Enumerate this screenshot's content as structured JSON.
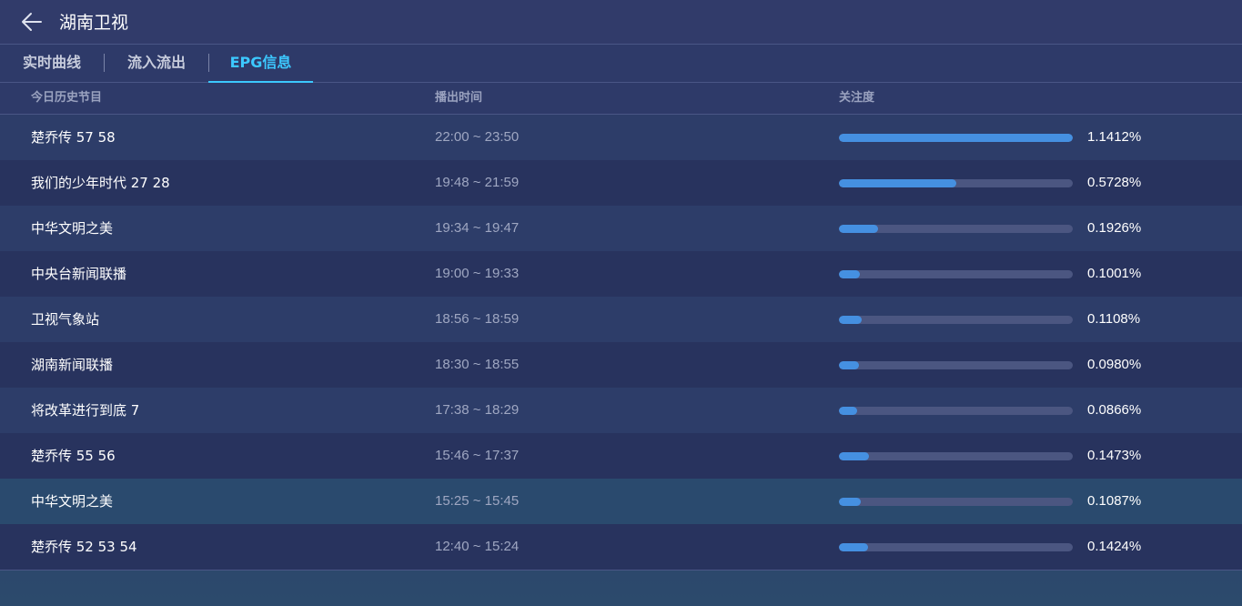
{
  "header": {
    "title": "湖南卫视",
    "back_icon": "arrow-left-icon"
  },
  "tabs": [
    {
      "label": "实时曲线",
      "active": false
    },
    {
      "label": "流入流出",
      "active": false
    },
    {
      "label": "EPG信息",
      "active": true
    }
  ],
  "colors": {
    "accent": "#3cc8ff",
    "bar_fill": "#4590e1",
    "bar_track": "#4b5681"
  },
  "table": {
    "columns": [
      "今日历史节目",
      "播出时间",
      "关注度"
    ],
    "rows": [
      {
        "name": "楚乔传 57 58",
        "time": "22:00 ~ 23:50",
        "attention": "1.1412%",
        "fill": 1.0
      },
      {
        "name": "我们的少年时代 27 28",
        "time": "19:48 ~ 21:59",
        "attention": "0.5728%",
        "fill": 0.502
      },
      {
        "name": "中华文明之美",
        "time": "19:34 ~ 19:47",
        "attention": "0.1926%",
        "fill": 0.169
      },
      {
        "name": "中央台新闻联播",
        "time": "19:00 ~ 19:33",
        "attention": "0.1001%",
        "fill": 0.088
      },
      {
        "name": "卫视气象站",
        "time": "18:56 ~ 18:59",
        "attention": "0.1108%",
        "fill": 0.097
      },
      {
        "name": "湖南新闻联播",
        "time": "18:30 ~ 18:55",
        "attention": "0.0980%",
        "fill": 0.086
      },
      {
        "name": "将改革进行到底 7",
        "time": "17:38 ~ 18:29",
        "attention": "0.0866%",
        "fill": 0.076
      },
      {
        "name": "楚乔传 55 56",
        "time": "15:46 ~ 17:37",
        "attention": "0.1473%",
        "fill": 0.129
      },
      {
        "name": "中华文明之美",
        "time": "15:25 ~ 15:45",
        "attention": "0.1087%",
        "fill": 0.095
      },
      {
        "name": "楚乔传 52 53 54",
        "time": "12:40 ~ 15:24",
        "attention": "0.1424%",
        "fill": 0.125
      }
    ]
  }
}
